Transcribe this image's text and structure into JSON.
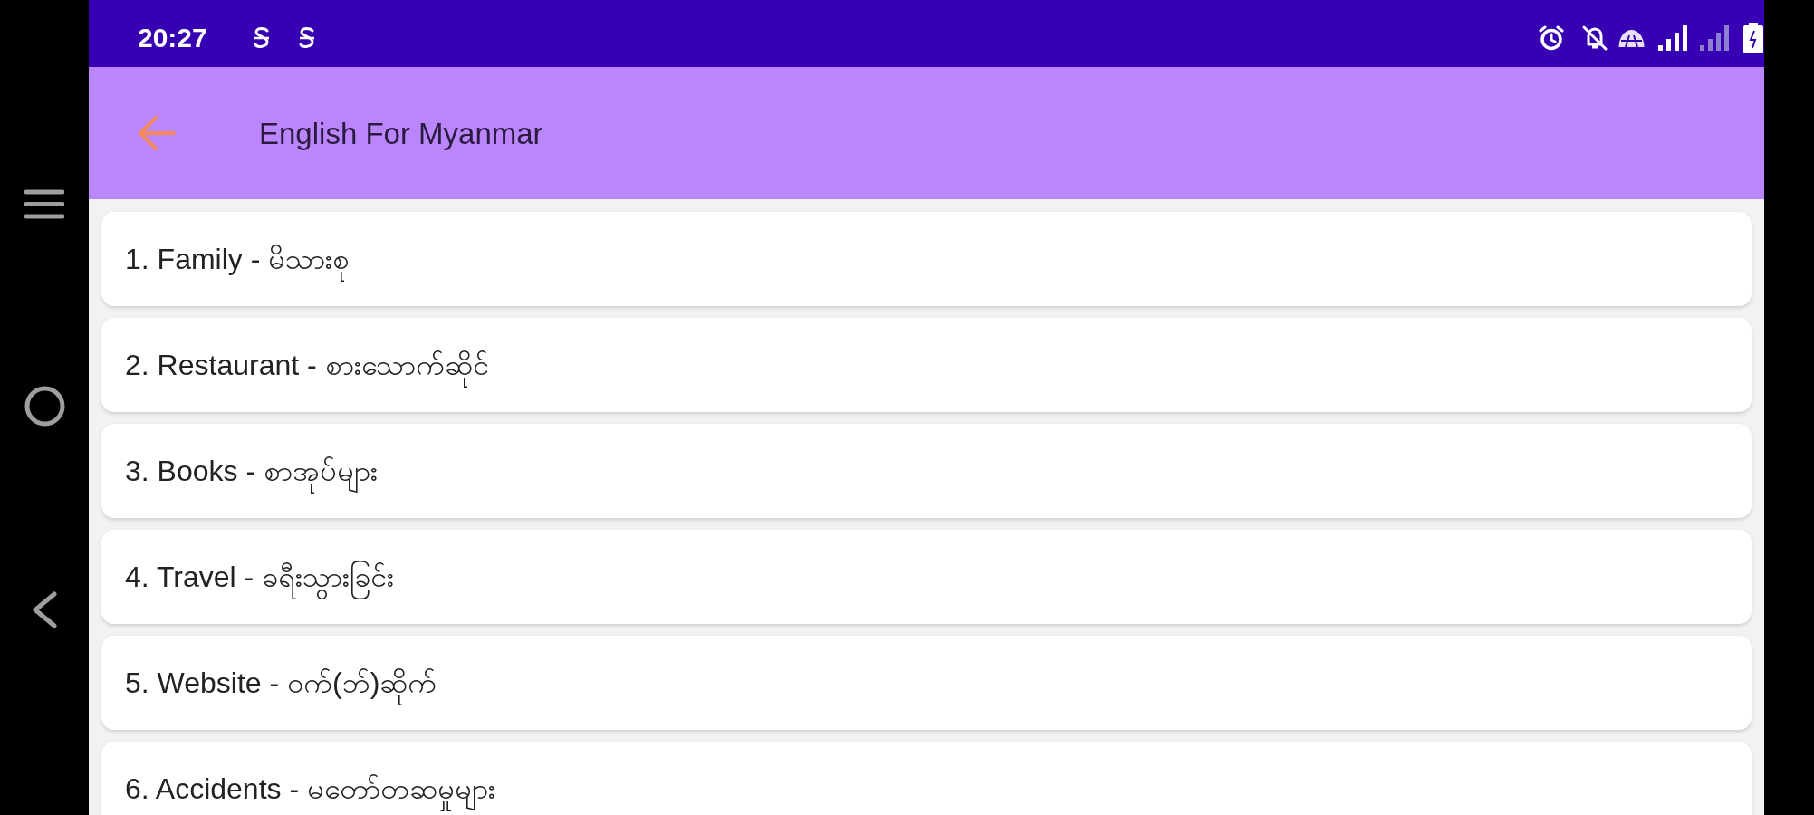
{
  "status_bar": {
    "time": "20:27"
  },
  "app_bar": {
    "title": "English For Myanmar"
  },
  "lessons": [
    {
      "label": "1. Family - မိသားစု"
    },
    {
      "label": "2. Restaurant - စားသောက်ဆိုင်"
    },
    {
      "label": "3. Books - စာအုပ်များ"
    },
    {
      "label": "4. Travel - ခရီးသွားခြင်း"
    },
    {
      "label": "5. Website - ဝက်(ဘ်)ဆိုက်"
    },
    {
      "label": "6. Accidents - မတော်တဆမှုများ"
    }
  ]
}
